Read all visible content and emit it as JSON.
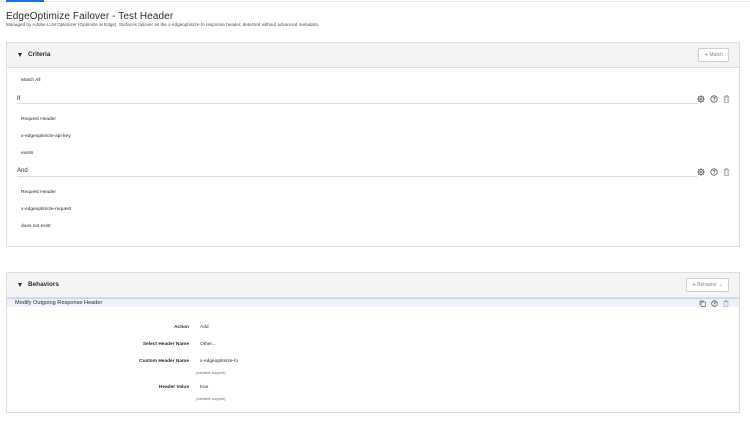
{
  "page": {
    "title": "EdgeOptimize Failover - Test Header",
    "subtitle": "Managed by Adobe LLM Optimizer (Optimize at Edge). Surfaces failover as the x-edgeoptimize-fo response header, detected without advanced metadata."
  },
  "criteria": {
    "title": "Criteria",
    "add_button": "Match",
    "match_mode": "Match All",
    "conditions": [
      {
        "label": "If",
        "type": "Request Header",
        "name": "x-edgeoptimize-api-key",
        "operator": "exists"
      },
      {
        "label": "And",
        "type": "Request Header",
        "name": "x-edgeoptimize-request",
        "operator": "does not exist"
      }
    ]
  },
  "behaviors": {
    "title": "Behaviors",
    "add_button": "Behavior",
    "items": [
      {
        "title": "Modify Outgoing Response Header",
        "fields": {
          "action_label": "Action",
          "action_value": "Add",
          "select_label": "Select Header Name",
          "select_value": "Other...",
          "custom_label": "Custom Header Name",
          "custom_value": "x-edgeoptimize-fo",
          "custom_hint": "(variable support)",
          "value_label": "Header Value",
          "value_value": "true",
          "value_hint": "(variable support)"
        }
      }
    ]
  },
  "icons": {
    "settings": "gear-icon",
    "help": "help-icon",
    "delete": "trash-icon",
    "copy": "copy-icon",
    "collapse": "caret-down-icon",
    "add": "plus-icon",
    "dropdown": "chevron-down-icon"
  },
  "colors": {
    "accent": "#1473e6",
    "panel_header_bg": "#f4f4f4",
    "behavior_bar_bg": "#eef2f8",
    "border": "#dedede"
  }
}
